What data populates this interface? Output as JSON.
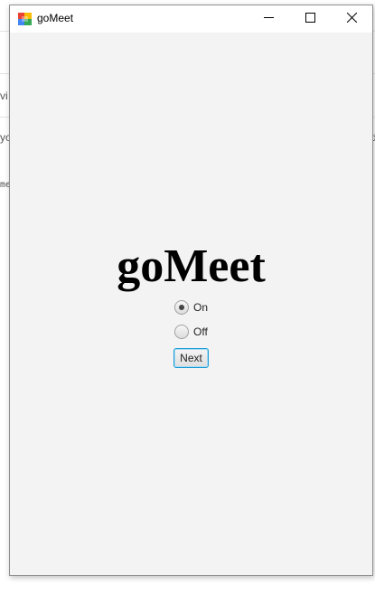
{
  "background_fragments": {
    "frag1": "vi",
    "frag2": "yo",
    "frag3": "me",
    "frag4": "d"
  },
  "window": {
    "title": "goMeet",
    "app_icon": "google-meet-icon",
    "controls": {
      "minimize_icon": "minimize-icon",
      "maximize_icon": "maximize-icon",
      "close_icon": "close-icon"
    }
  },
  "main": {
    "heading": "goMeet",
    "radio_options": [
      {
        "label": "On",
        "selected": true
      },
      {
        "label": "Off",
        "selected": false
      }
    ],
    "next_label": "Next"
  },
  "colors": {
    "window_background": "#f3f3f3",
    "focus_border": "#1b9bd6"
  }
}
